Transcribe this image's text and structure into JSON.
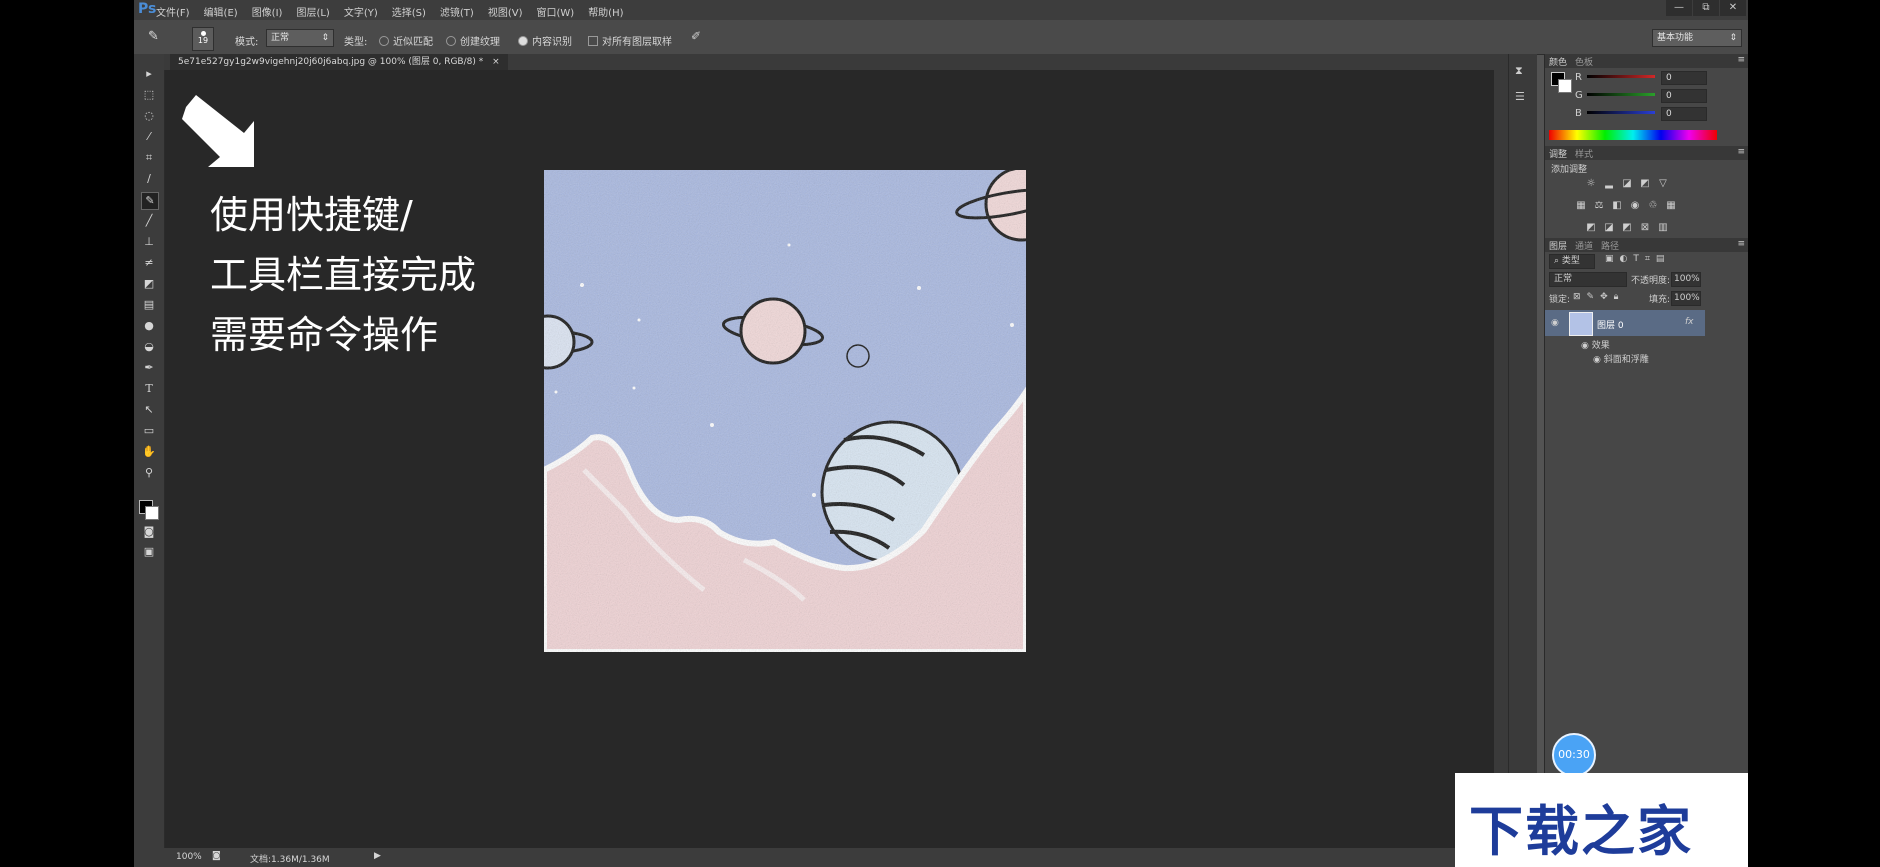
{
  "app": {
    "logo": "Ps",
    "menu": [
      "文件(F)",
      "编辑(E)",
      "图像(I)",
      "图层(L)",
      "文字(Y)",
      "选择(S)",
      "滤镜(T)",
      "视图(V)",
      "窗口(W)",
      "帮助(H)"
    ],
    "window_controls": [
      "—",
      "⧉",
      "✕"
    ]
  },
  "options_bar": {
    "brush_size": "19",
    "mode_label": "模式:",
    "mode_value": "正常",
    "type_label": "类型:",
    "type_options": [
      "近似匹配",
      "创建纹理",
      "内容识别"
    ],
    "type_selected_index": 2,
    "sample_all_layers": "对所有图层取样",
    "workspace": "基本功能"
  },
  "document": {
    "tab_title": "5e71e527gy1g2w9vigehnj20j60j6abq.jpg @ 100% (图层 0, RGB/8) *",
    "tab_close": "×"
  },
  "overlay": {
    "lines": [
      "使用快捷键/",
      "工具栏直接完成",
      "需要命令操作"
    ],
    "arrow_icon": "arrow-icon"
  },
  "status_bar": {
    "zoom": "100%",
    "doc_info": "文档:1.36M/1.36M"
  },
  "color_panel": {
    "tabs": [
      "颜色",
      "色板"
    ],
    "channels": [
      {
        "label": "R",
        "value": "0",
        "color": "#d12828"
      },
      {
        "label": "G",
        "value": "0",
        "color": "#2aa02a"
      },
      {
        "label": "B",
        "value": "0",
        "color": "#2a3fd6"
      }
    ]
  },
  "adjust_panel": {
    "tabs": [
      "调整",
      "样式"
    ],
    "title": "添加调整"
  },
  "layers_panel": {
    "tabs": [
      "图层",
      "通道",
      "路径"
    ],
    "filter_label": "类型",
    "blend_mode": "正常",
    "opacity_label": "不透明度:",
    "opacity_value": "100%",
    "lock_label": "锁定:",
    "fill_label": "填充:",
    "fill_value": "100%",
    "layer_name": "图层 0",
    "fx": "fx",
    "effects_label": "效果",
    "effect_item": "斜面和浮雕"
  },
  "timer": "00:30",
  "watermark": "下载之家",
  "colors": {
    "sky": "#a7b7e0",
    "ground": "#f0d2d4",
    "planet": "#f2d8d8",
    "stripe_planet": "#d8e6f3"
  }
}
